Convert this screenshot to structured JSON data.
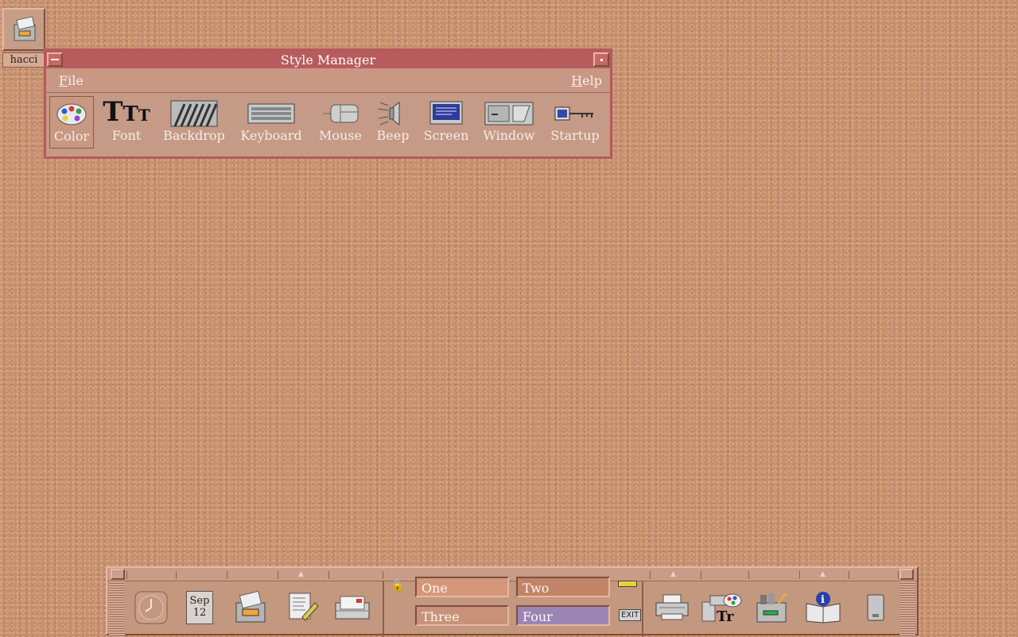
{
  "desktop": {
    "icon_label": "hacci"
  },
  "window": {
    "title": "Style Manager",
    "menu": {
      "file": "File",
      "file_mnemonic": "F",
      "file_rest": "ile",
      "help": "Help",
      "help_mnemonic": "H",
      "help_rest": "elp"
    },
    "tools": [
      "Color",
      "Font",
      "Backdrop",
      "Keyboard",
      "Mouse",
      "Beep",
      "Screen",
      "Window",
      "Startup"
    ]
  },
  "front_panel": {
    "calendar": {
      "month": "Sep",
      "day": "12"
    },
    "workspaces": [
      "One",
      "Two",
      "Three",
      "Four"
    ],
    "current_workspace": "Four",
    "exit_label": "EXIT"
  },
  "colors": {
    "titlebar": "#b85b5c",
    "active_workspace": "#9b85b5",
    "background": "#c48f6f"
  }
}
